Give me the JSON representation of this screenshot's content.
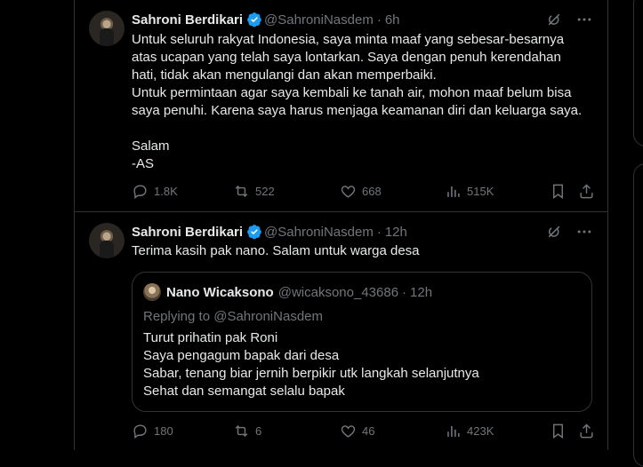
{
  "tweets": [
    {
      "author": "Sahroni Berdikari",
      "handle": "@SahroniNasdem",
      "time": "6h",
      "text": "Untuk seluruh rakyat Indonesia, saya minta maaf yang sebesar-besarnya\natas ucapan yang telah saya lontarkan. Saya dengan penuh kerendahan\nhati, tidak akan mengulangi dan akan memperbaiki.\nUntuk permintaan agar saya kembali ke tanah air, mohon maaf belum bisa\nsaya penuhi. Karena saya harus menjaga keamanan diri dan keluarga saya.\n\nSalam\n-AS",
      "stats": {
        "replies": "1.8K",
        "retweets": "522",
        "likes": "668",
        "views": "515K"
      }
    },
    {
      "author": "Sahroni Berdikari",
      "handle": "@SahroniNasdem",
      "time": "12h",
      "text": "Terima kasih pak nano. Salam untuk warga desa",
      "quote": {
        "author": "Nano Wicaksono",
        "handle": "@wicaksono_43686",
        "time": "12h",
        "replying_to": "Replying to @SahroniNasdem",
        "text": "Turut prihatin pak Roni\nSaya pengagum bapak dari desa\nSabar, tenang biar jernih berpikir utk langkah selanjutnya\nSehat dan semangat selalu bapak"
      },
      "stats": {
        "replies": "180",
        "retweets": "6",
        "likes": "46",
        "views": "423K"
      }
    }
  ],
  "dot": "·",
  "icons": {
    "verified": "verified-badge-icon",
    "grok": "grok-icon",
    "more": "more-icon",
    "reply": "reply-icon",
    "retweet": "retweet-icon",
    "like": "heart-icon",
    "views": "views-chart-icon",
    "bookmark": "bookmark-icon",
    "share": "share-icon"
  },
  "colors": {
    "background": "#000000",
    "text": "#e7e9ea",
    "muted": "#71767b",
    "border": "#2f3336",
    "verified": "#1d9bf0"
  }
}
